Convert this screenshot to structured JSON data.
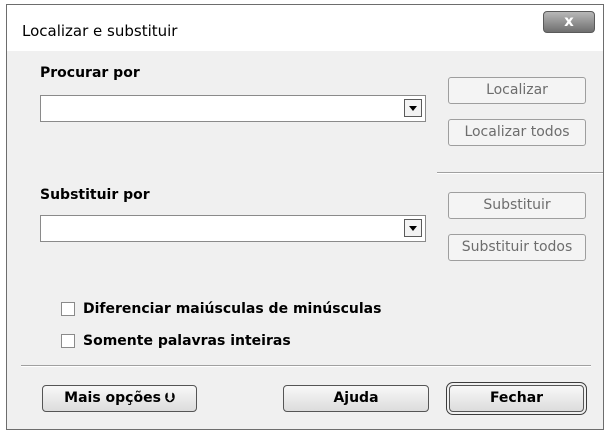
{
  "window": {
    "title": "Localizar e substituir",
    "close_label": "x"
  },
  "search": {
    "label": "Procurar por",
    "value": ""
  },
  "replace": {
    "label": "Substituir por",
    "value": ""
  },
  "buttons": {
    "find": "Localizar",
    "find_all": "Localizar todos",
    "replace": "Substituir",
    "replace_all": "Substituir todos",
    "more_options": "Mais opções",
    "more_options_icon": "double-chevron-down-icon",
    "help": "Ajuda",
    "close": "Fechar"
  },
  "options": [
    {
      "label": "Diferenciar maiúsculas de minúsculas",
      "checked": false
    },
    {
      "label": "Somente palavras inteiras",
      "checked": false
    }
  ]
}
